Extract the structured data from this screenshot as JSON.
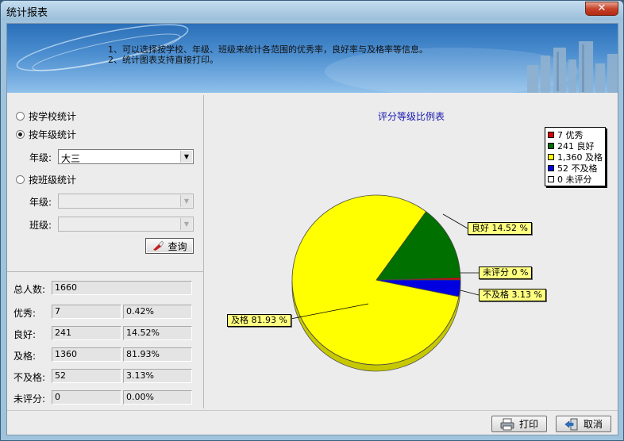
{
  "window": {
    "title": "统计报表",
    "close_symbol": "✕"
  },
  "banner": {
    "line1": "1、可以选择按学校、年级、班级来统计各范围的优秀率，良好率与及格率等信息。",
    "line2": "2、统计图表支持直接打印。"
  },
  "filters": {
    "by_school": "按学校统计",
    "by_grade": "按年级统计",
    "by_class": "按班级统计",
    "grade_label": "年级:",
    "grade_value": "大三",
    "class_grade_label": "年级:",
    "class_label": "班级:",
    "selected": "by_grade",
    "query_button": "查询"
  },
  "stats": {
    "total_label": "总人数:",
    "total_value": "1660",
    "rows": [
      {
        "label": "优秀:",
        "count": "7",
        "pct": "0.42%"
      },
      {
        "label": "良好:",
        "count": "241",
        "pct": "14.52%"
      },
      {
        "label": "及格:",
        "count": "1360",
        "pct": "81.93%"
      },
      {
        "label": "不及格:",
        "count": "52",
        "pct": "3.13%"
      },
      {
        "label": "未评分:",
        "count": "0",
        "pct": "0.00%"
      }
    ]
  },
  "chart_data": {
    "type": "pie",
    "title": "评分等级比例表",
    "legend_position": "top-right",
    "slices": [
      {
        "name": "优秀",
        "value": 7,
        "legend": "7 优秀",
        "color": "#e00000"
      },
      {
        "name": "良好",
        "value": 241,
        "legend": "241 良好",
        "label": "良好 14.52 %",
        "color": "#007000"
      },
      {
        "name": "及格",
        "value": 1360,
        "legend": "1,360 及格",
        "label": "及格 81.93 %",
        "color": "#ffff00"
      },
      {
        "name": "不及格",
        "value": 52,
        "legend": "52 不及格",
        "label": "不及格 3.13 %",
        "color": "#0000e0"
      },
      {
        "name": "未评分",
        "value": 0,
        "legend": "0 未评分",
        "label": "未评分 0 %",
        "color": "#ffffff"
      }
    ]
  },
  "footer": {
    "print_button": "打印",
    "cancel_button": "取消"
  }
}
